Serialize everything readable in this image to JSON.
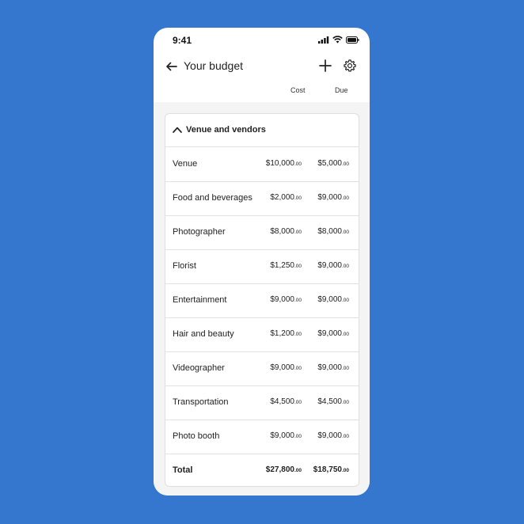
{
  "status": {
    "time": "9:41"
  },
  "header": {
    "title": "Your budget",
    "col_cost": "Cost",
    "col_due": "Due"
  },
  "section": {
    "title": "Venue and vendors"
  },
  "rows": [
    {
      "name": "Venue",
      "cost": "$10,000",
      "cost_cents": ".00",
      "due": "$5,000",
      "due_cents": ".00"
    },
    {
      "name": "Food and beverages",
      "cost": "$2,000",
      "cost_cents": ".00",
      "due": "$9,000",
      "due_cents": ".00"
    },
    {
      "name": "Photographer",
      "cost": "$8,000",
      "cost_cents": ".00",
      "due": "$8,000",
      "due_cents": ".00"
    },
    {
      "name": "Florist",
      "cost": "$1,250",
      "cost_cents": ".00",
      "due": "$9,000",
      "due_cents": ".00"
    },
    {
      "name": "Entertainment",
      "cost": "$9,000",
      "cost_cents": ".00",
      "due": "$9,000",
      "due_cents": ".00"
    },
    {
      "name": "Hair and beauty",
      "cost": "$1,200",
      "cost_cents": ".00",
      "due": "$9,000",
      "due_cents": ".00"
    },
    {
      "name": "Videographer",
      "cost": "$9,000",
      "cost_cents": ".00",
      "due": "$9,000",
      "due_cents": ".00"
    },
    {
      "name": "Transportation",
      "cost": "$4,500",
      "cost_cents": ".00",
      "due": "$4,500",
      "due_cents": ".00"
    },
    {
      "name": "Photo booth",
      "cost": "$9,000",
      "cost_cents": ".00",
      "due": "$9,000",
      "due_cents": ".00"
    }
  ],
  "total": {
    "name": "Total",
    "cost": "$27,800",
    "cost_cents": ".00",
    "due": "$18,750",
    "due_cents": ".00"
  },
  "icons": {
    "back": "arrow-left-icon",
    "add": "plus-icon",
    "settings": "gear-icon",
    "collapse": "chevron-up-icon",
    "signal": "cellular-signal-icon",
    "wifi": "wifi-icon",
    "battery": "battery-icon"
  },
  "colors": {
    "background": "#3576cf",
    "card": "#ffffff",
    "content_bg": "#f4f4f4"
  }
}
